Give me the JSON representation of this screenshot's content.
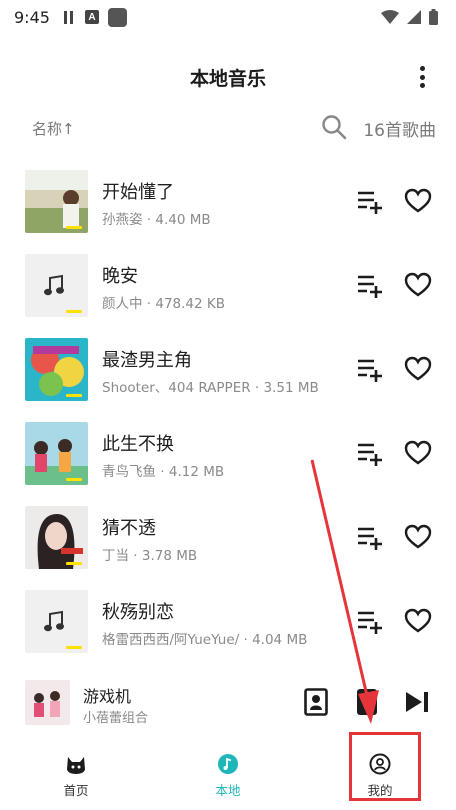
{
  "status_bar": {
    "time": "9:45",
    "a_glyph": "A"
  },
  "header": {
    "title": "本地音乐"
  },
  "sort": {
    "label": "名称↑",
    "count": "16首歌曲"
  },
  "songs": [
    {
      "title": "开始懂了",
      "meta": "孙燕姿 · 4.40 MB",
      "cover": "photo"
    },
    {
      "title": "晚安",
      "meta": "颜人中 · 478.42 KB",
      "cover": "placeholder"
    },
    {
      "title": "最渣男主角",
      "meta": "Shooter、404 RAPPER · 3.51 MB",
      "cover": "art"
    },
    {
      "title": "此生不换",
      "meta": "青鸟飞鱼 · 4.12 MB",
      "cover": "art2"
    },
    {
      "title": "猜不透",
      "meta": "丁当 · 3.78 MB",
      "cover": "photo2"
    },
    {
      "title": "秋殇别恋",
      "meta": "格雷西西西/阿YueYue/ · 4.04 MB",
      "cover": "placeholder"
    }
  ],
  "mini_player": {
    "title": "游戏机",
    "artist": "小蓓蕾组合"
  },
  "nav": [
    {
      "label": "首页",
      "icon": "cat-icon"
    },
    {
      "label": "本地",
      "icon": "music-note-icon"
    },
    {
      "label": "我的",
      "icon": "profile-icon"
    }
  ],
  "colors": {
    "accent": "#1fb6b9",
    "annotation": "#e5353a",
    "tag": "#ffe100"
  }
}
